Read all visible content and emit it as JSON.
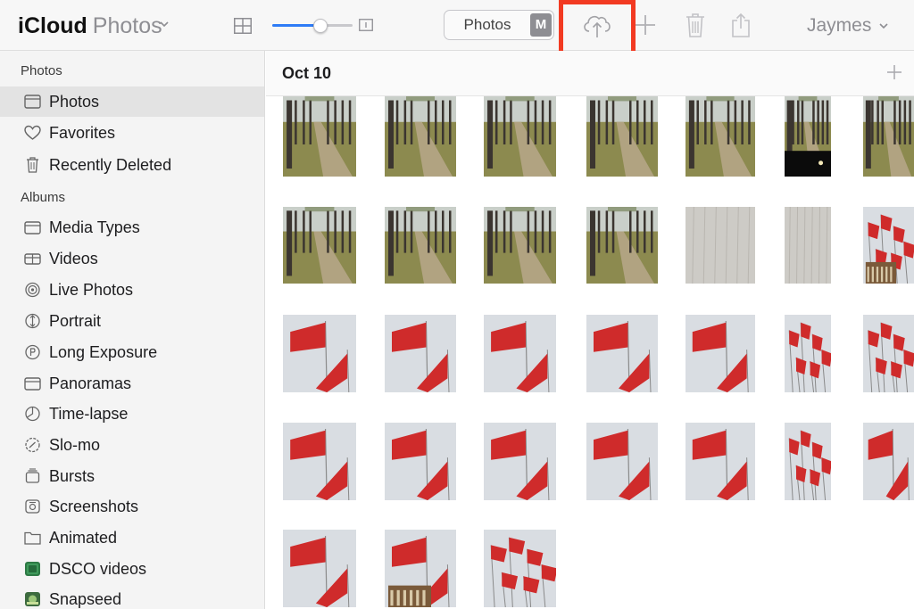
{
  "topbar": {
    "brand": "iCloud",
    "app": "Photos",
    "segment": {
      "photos": "Photos",
      "memories": "M"
    },
    "user": "Jaymes"
  },
  "sidebar": {
    "section_photos": "Photos",
    "photos_items": [
      {
        "label": "Photos",
        "icon": "photos-icon",
        "selected": true
      },
      {
        "label": "Favorites",
        "icon": "heart-icon"
      },
      {
        "label": "Recently Deleted",
        "icon": "trash-icon"
      }
    ],
    "section_albums": "Albums",
    "album_items": [
      {
        "label": "Media Types",
        "icon": "folder-icon"
      },
      {
        "label": "Videos",
        "icon": "video-icon"
      },
      {
        "label": "Live Photos",
        "icon": "live-photo-icon"
      },
      {
        "label": "Portrait",
        "icon": "portrait-icon"
      },
      {
        "label": "Long Exposure",
        "icon": "long-exposure-icon"
      },
      {
        "label": "Panoramas",
        "icon": "panorama-icon"
      },
      {
        "label": "Time-lapse",
        "icon": "timelapse-icon"
      },
      {
        "label": "Slo-mo",
        "icon": "slomo-icon"
      },
      {
        "label": "Bursts",
        "icon": "bursts-icon"
      },
      {
        "label": "Screenshots",
        "icon": "screenshot-icon"
      },
      {
        "label": "Animated",
        "icon": "animated-icon"
      },
      {
        "label": "DSCO videos",
        "icon": "dsco-app-icon"
      },
      {
        "label": "Snapseed",
        "icon": "snapseed-app-icon"
      }
    ]
  },
  "content": {
    "date": "Oct 10",
    "rows": [
      [
        "path",
        "path",
        "path",
        "path",
        "path",
        "path-night",
        "path"
      ],
      [
        "path",
        "path",
        "path",
        "path",
        "wall",
        "wall",
        "flags-building"
      ],
      [
        "flag",
        "flag",
        "flag",
        "flag",
        "flag",
        "flags-many",
        "flags-many"
      ],
      [
        "flag",
        "flag",
        "flag",
        "flag",
        "flag",
        "flags-many",
        "flag"
      ],
      [
        "flag",
        "flag-building",
        "flags-many"
      ]
    ]
  },
  "colors": {
    "accent": "#2f7cf6",
    "highlight": "#f23a22",
    "flag": "#cf2b2b",
    "sky": "#d9dde2"
  }
}
